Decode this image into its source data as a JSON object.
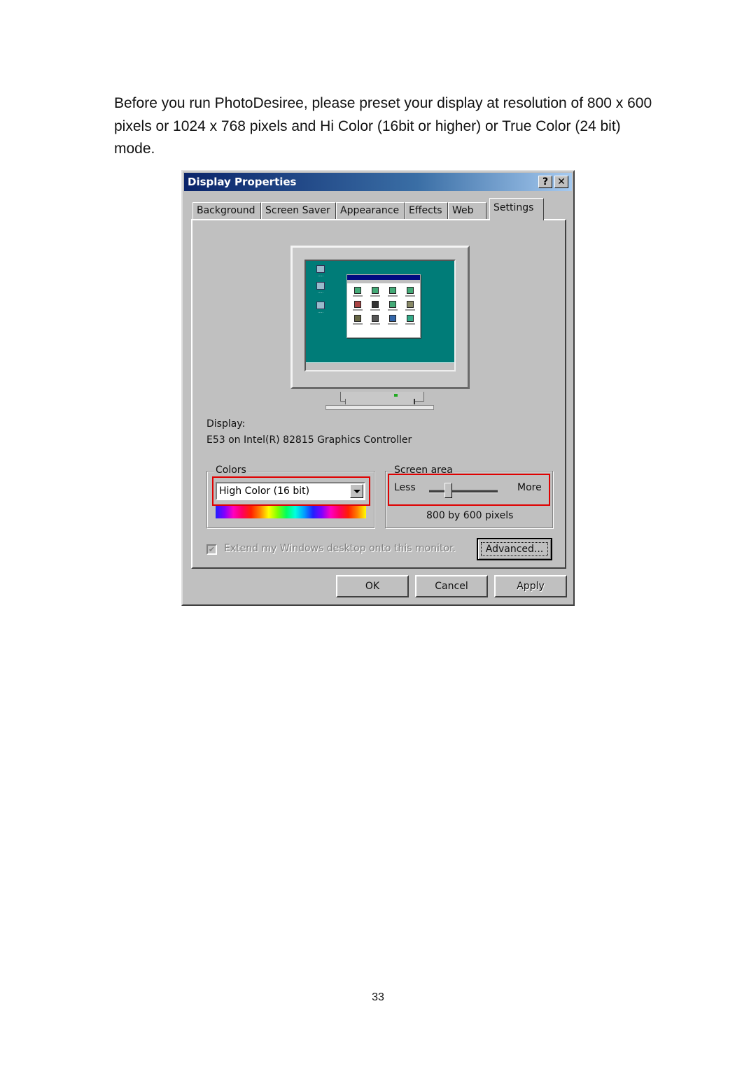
{
  "document": {
    "intro_text": "Before you run PhotoDesiree, please preset your display at resolution of 800 x 600 pixels or 1024 x 768 pixels and Hi Color (16bit or higher) or True Color (24 bit) mode.",
    "page_number": "33"
  },
  "dialog": {
    "title": "Display Properties",
    "help_glyph": "?",
    "close_glyph": "✕",
    "tabs": [
      {
        "label": "Background",
        "active": false
      },
      {
        "label": "Screen Saver",
        "active": false
      },
      {
        "label": "Appearance",
        "active": false
      },
      {
        "label": "Effects",
        "active": false
      },
      {
        "label": "Web",
        "active": false
      },
      {
        "label": "Settings",
        "active": true
      }
    ],
    "display_label": "Display:",
    "display_value": "E53 on Intel(R) 82815 Graphics Controller",
    "colors": {
      "group_label": "Colors",
      "selected": "High Color (16 bit)"
    },
    "screen_area": {
      "group_label": "Screen area",
      "less_label": "Less",
      "more_label": "More",
      "slider_position_fraction": 0.28,
      "resolution_text": "800 by 600 pixels"
    },
    "extend_checkbox": {
      "label": "Extend my Windows desktop onto this monitor.",
      "checked": true,
      "enabled": false
    },
    "buttons": {
      "advanced": "Advanced...",
      "ok": "OK",
      "cancel": "Cancel",
      "apply": "Apply"
    },
    "highlight_color": "#e00000"
  }
}
